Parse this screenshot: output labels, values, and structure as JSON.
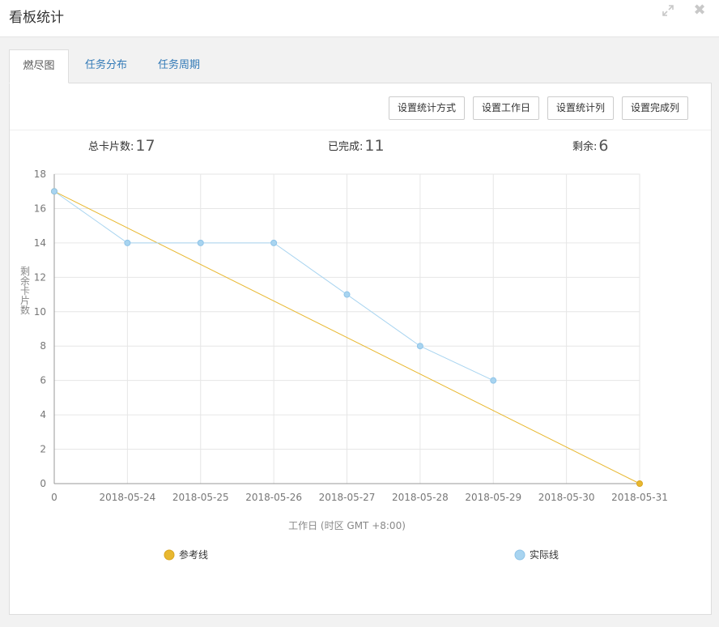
{
  "dialog": {
    "title": "看板统计",
    "maximize_icon": "expand-icon",
    "close_icon": "close-icon",
    "close_glyph": "✖"
  },
  "tabs": [
    {
      "label": "燃尽图",
      "active": true
    },
    {
      "label": "任务分布",
      "active": false
    },
    {
      "label": "任务周期",
      "active": false
    }
  ],
  "toolbar": {
    "buttons": [
      "设置统计方式",
      "设置工作日",
      "设置统计列",
      "设置完成列"
    ]
  },
  "stats": {
    "total_label": "总卡片数:",
    "total_value": "17",
    "done_label": "已完成:",
    "done_value": "11",
    "remaining_label": "剩余:",
    "remaining_value": "6"
  },
  "chart_data": {
    "type": "line",
    "x": [
      "0",
      "2018-05-24",
      "2018-05-25",
      "2018-05-26",
      "2018-05-27",
      "2018-05-28",
      "2018-05-29",
      "2018-05-30",
      "2018-05-31"
    ],
    "xlabel": "工作日 (时区 GMT +8:00)",
    "ylabel": "剩余卡片数",
    "ylim": [
      0,
      18
    ],
    "yticks": [
      0,
      2,
      4,
      6,
      8,
      10,
      12,
      14,
      16,
      18
    ],
    "grid": true,
    "legend_position": "bottom",
    "series": [
      {
        "name": "参考线",
        "color": "#e8b830",
        "values": [
          17,
          null,
          null,
          null,
          null,
          null,
          null,
          null,
          0
        ]
      },
      {
        "name": "实际线",
        "color": "#a8d4f0",
        "values": [
          17,
          14,
          14,
          14,
          11,
          8,
          6,
          null,
          null
        ]
      }
    ]
  }
}
